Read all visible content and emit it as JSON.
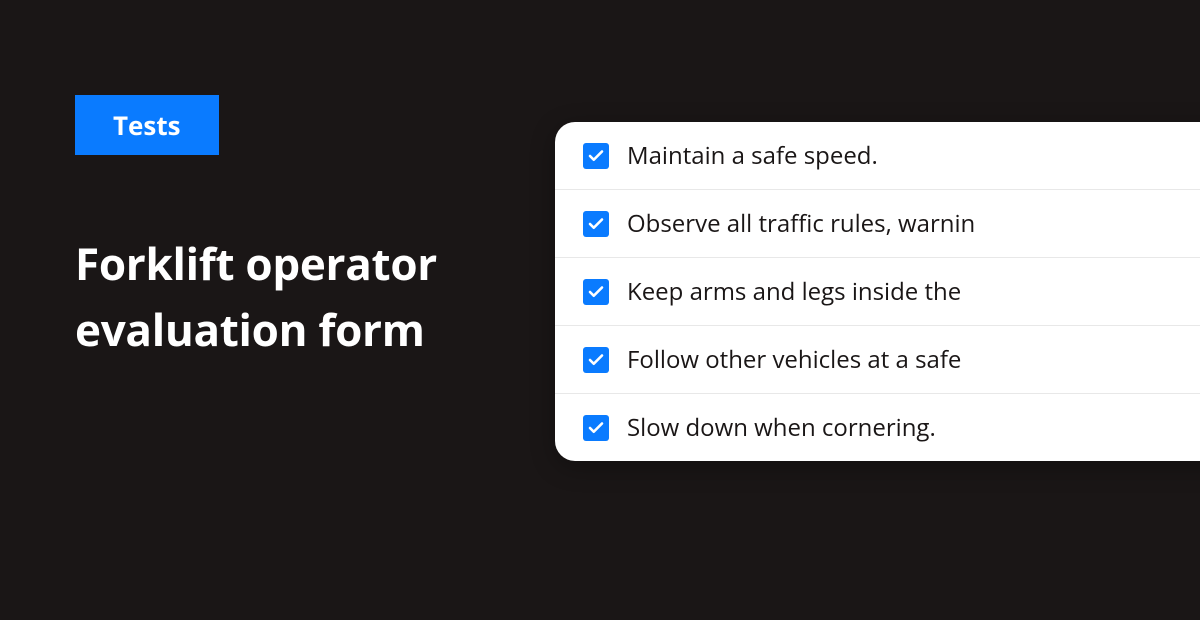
{
  "badge": {
    "label": "Tests"
  },
  "heading": "Forklift operator evaluation form",
  "checklist": {
    "items": [
      {
        "label": "Maintain a safe speed.",
        "checked": true
      },
      {
        "label": "Observe all traffic rules, warnin",
        "checked": true
      },
      {
        "label": "Keep arms and legs inside the",
        "checked": true
      },
      {
        "label": "Follow other vehicles at a safe",
        "checked": true
      },
      {
        "label": "Slow down when cornering.",
        "checked": true
      }
    ]
  },
  "colors": {
    "background": "#1a1616",
    "accent": "#0a7bff",
    "card": "#ffffff",
    "text_dark": "#1a1616",
    "text_light": "#ffffff"
  }
}
